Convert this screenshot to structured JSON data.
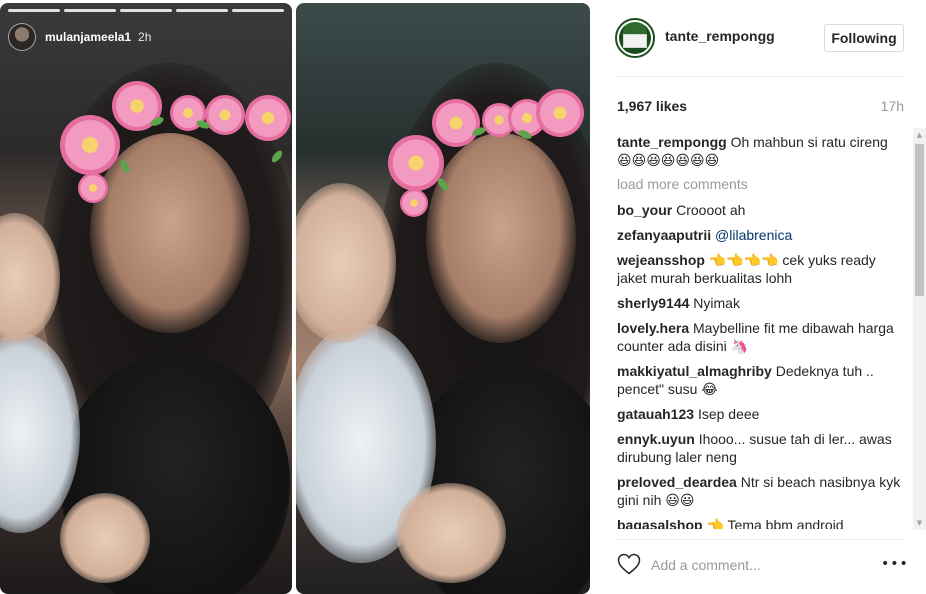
{
  "story": {
    "username": "mulanjameela1",
    "time": "2h"
  },
  "post": {
    "author": "tante_rempongg",
    "follow_label": "Following",
    "likes": "1,967 likes",
    "age": "17h",
    "caption_user": "tante_rempongg",
    "caption_text": "Oh mahbun si ratu cireng 😆😆😆😆😆😆😆",
    "load_more": "load more comments",
    "comments": [
      {
        "user": "bo_your",
        "text": "Croooot ah"
      },
      {
        "user": "zefanyaaputrii",
        "text": "@lilabrenica"
      },
      {
        "user": "wejeansshop",
        "text": "👈👈👈👈 cek yuks ready jaket murah berkualitas lohh"
      },
      {
        "user": "sherly9144",
        "text": "Nyimak"
      },
      {
        "user": "lovely.hera",
        "text": "Maybelline fit me dibawah harga counter ada disini 🦄"
      },
      {
        "user": "makkiyatul_almaghriby",
        "text": "Dedeknya tuh .. pencet\" susu 😂"
      },
      {
        "user": "gatauah123",
        "text": "Isep deee"
      },
      {
        "user": "ennyk.uyun",
        "text": "Ihooo... susue tah di ler... awas dirubung laler neng"
      },
      {
        "user": "preloved_deardea",
        "text": "Ntr si beach nasibnya kyk gini nih 😃😃"
      },
      {
        "user": "bagasalshop",
        "text": "👈 Tema bbm android"
      }
    ],
    "add_comment_placeholder": "Add a comment...",
    "more_label": "•••"
  },
  "icons": {
    "heart": "heart-icon",
    "more": "more-options-icon",
    "scroll_up": "scroll-up-arrow",
    "scroll_down": "scroll-down-arrow"
  },
  "colors": {
    "text": "#262626",
    "muted": "#999999",
    "border": "#dbdbdb"
  }
}
